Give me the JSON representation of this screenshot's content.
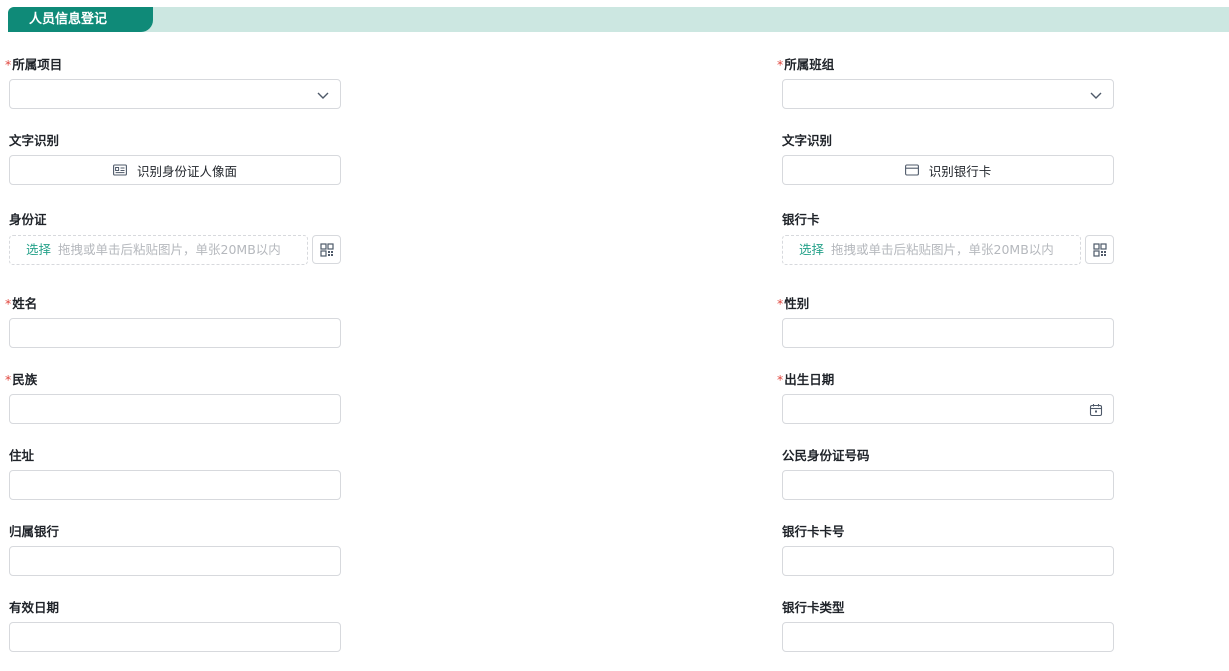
{
  "section": {
    "title": "人员信息登记"
  },
  "fields": {
    "project": {
      "label": "所属项目",
      "required": true,
      "value": ""
    },
    "team": {
      "label": "所属班组",
      "required": true,
      "value": ""
    },
    "ocr_left": {
      "label": "文字识别",
      "button_label": "识别身份证人像面",
      "icon": "id-card-icon"
    },
    "ocr_right": {
      "label": "文字识别",
      "button_label": "识别银行卡",
      "icon": "bank-card-icon"
    },
    "id_card": {
      "label": "身份证",
      "pick_label": "选择",
      "hint": "拖拽或单击后粘贴图片，单张20MB以内"
    },
    "bank_card": {
      "label": "银行卡",
      "pick_label": "选择",
      "hint": "拖拽或单击后粘贴图片，单张20MB以内"
    },
    "name": {
      "label": "姓名",
      "required": true,
      "value": ""
    },
    "gender": {
      "label": "性别",
      "required": true,
      "value": ""
    },
    "ethnicity": {
      "label": "民族",
      "required": true,
      "value": ""
    },
    "birth_date": {
      "label": "出生日期",
      "required": true,
      "value": ""
    },
    "address": {
      "label": "住址",
      "value": ""
    },
    "id_number": {
      "label": "公民身份证号码",
      "value": ""
    },
    "bank_name": {
      "label": "归属银行",
      "value": ""
    },
    "bank_card_number": {
      "label": "银行卡卡号",
      "value": ""
    },
    "valid_date": {
      "label": "有效日期",
      "value": ""
    },
    "bank_card_type": {
      "label": "银行卡类型",
      "value": ""
    }
  },
  "required_mark": "*",
  "colors": {
    "accent": "#0f8a78",
    "header_band": "#cce7e1",
    "link": "#26a28a",
    "required": "#e0463e"
  }
}
